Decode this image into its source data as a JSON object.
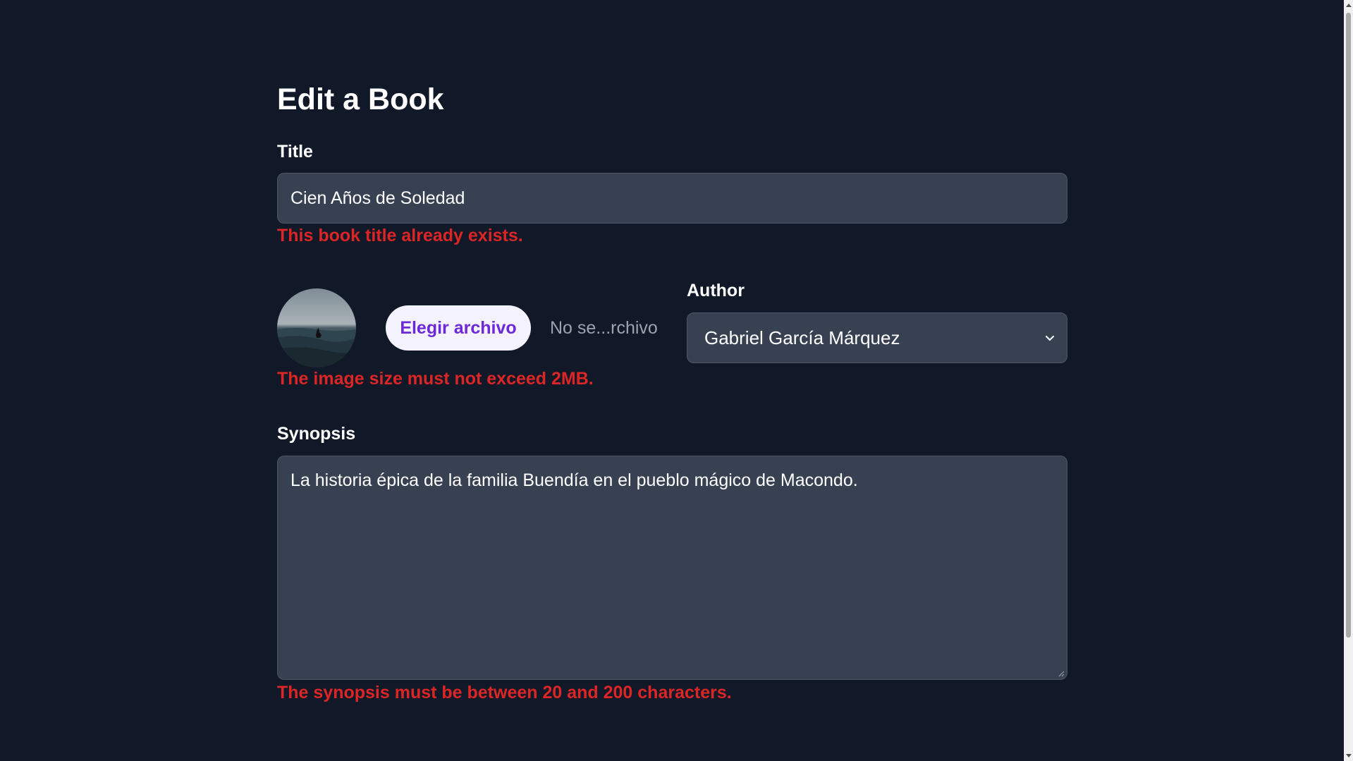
{
  "page": {
    "heading": "Edit a Book"
  },
  "title_field": {
    "label": "Title",
    "value": "Cien Años de Soledad",
    "error": "This book title already exists."
  },
  "image_field": {
    "avatar_icon": "book-cover-thumbnail",
    "button_label": "Elegir archivo",
    "file_status": "No se...rchivo",
    "error": "The image size must not exceed 2MB."
  },
  "author_field": {
    "label": "Author",
    "selected": "Gabriel García Márquez",
    "icon": "chevron-down-icon"
  },
  "synopsis_field": {
    "label": "Synopsis",
    "value": "La historia épica de la familia Buendía en el pueblo mágico de Macondo.",
    "error": "The synopsis must be between 20 and 200 characters."
  },
  "colors": {
    "background": "#111827",
    "input_background": "#374151",
    "error": "#dc2626",
    "button_background": "#f5f3ff",
    "button_text": "#6d28d9"
  }
}
